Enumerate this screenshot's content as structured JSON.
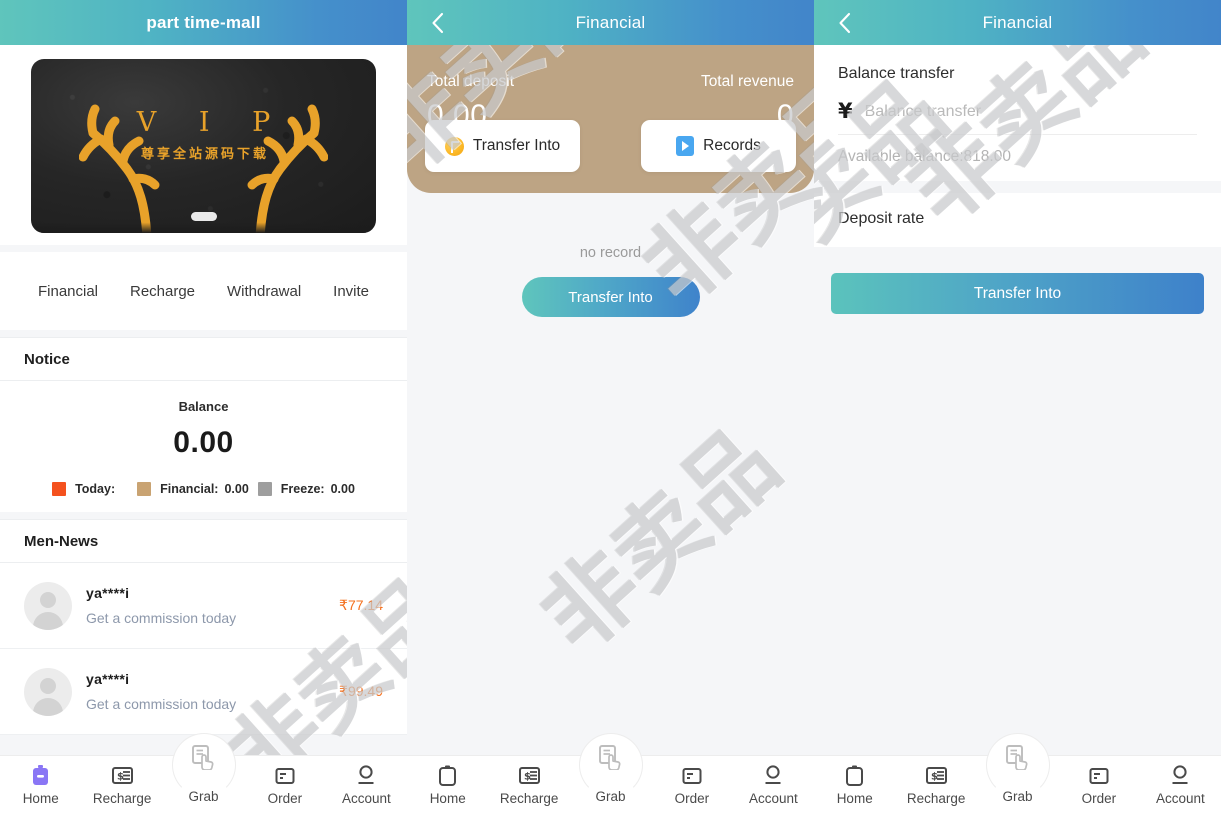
{
  "watermark": {
    "text": "非卖品"
  },
  "panel1": {
    "header": {
      "title": "part time-mall"
    },
    "banner": {
      "vip_text": "V I P",
      "vip_subtitle": "尊享全站源码下载",
      "icon": "vip-banner-image"
    },
    "quicknav": [
      {
        "label": "Financial",
        "name": "quicknav-financial"
      },
      {
        "label": "Recharge",
        "name": "quicknav-recharge"
      },
      {
        "label": "Withdrawal",
        "name": "quicknav-withdrawal"
      },
      {
        "label": "Invite",
        "name": "quicknav-invite"
      }
    ],
    "notice": {
      "title": "Notice"
    },
    "balance": {
      "label": "Balance",
      "value": "0.00",
      "legend": [
        {
          "label": "Today:",
          "value": "",
          "color": "#f4511e"
        },
        {
          "label": "Financial:",
          "value": "0.00",
          "color": "#c9a372"
        },
        {
          "label": "Freeze:",
          "value": "0.00",
          "color": "#9e9e9e"
        }
      ]
    },
    "news": {
      "title": "Men-News",
      "items": [
        {
          "name": "ya****i",
          "desc": "Get a commission today",
          "amount": "₹77.14"
        },
        {
          "name": "ya****i",
          "desc": "Get a commission today",
          "amount": "₹99.49"
        }
      ]
    }
  },
  "panel2": {
    "header": {
      "title": "Financial",
      "back_icon": "back-chevron-icon"
    },
    "hero": {
      "deposit_label": "Total deposit",
      "deposit_value": "0.00",
      "revenue_label": "Total revenue",
      "revenue_value": "0",
      "bg_color": "#bda484"
    },
    "cards": [
      {
        "label": "Transfer Into",
        "icon": "coin-icon"
      },
      {
        "label": "Records",
        "icon": "document-icon"
      }
    ],
    "empty_text": "no record",
    "action_button": "Transfer Into"
  },
  "panel3": {
    "header": {
      "title": "Financial",
      "back_icon": "back-chevron-icon"
    },
    "form": {
      "label": "Balance transfer",
      "currency_symbol": "¥",
      "input_value": "",
      "input_placeholder": "Balance transfer",
      "available": "Available balance:818.00"
    },
    "rate": {
      "label": "Deposit rate"
    },
    "action_button": "Transfer Into"
  },
  "tabbar": {
    "items": [
      {
        "label": "Home",
        "icon": "home-icon",
        "active": true
      },
      {
        "label": "Recharge",
        "icon": "recharge-icon",
        "active": false
      },
      {
        "label": "Grab",
        "icon": "grab-hand-icon",
        "active": false,
        "center": true
      },
      {
        "label": "Order",
        "icon": "order-icon",
        "active": false
      },
      {
        "label": "Account",
        "icon": "account-icon",
        "active": false
      }
    ],
    "active_color": "#8a76f5"
  }
}
